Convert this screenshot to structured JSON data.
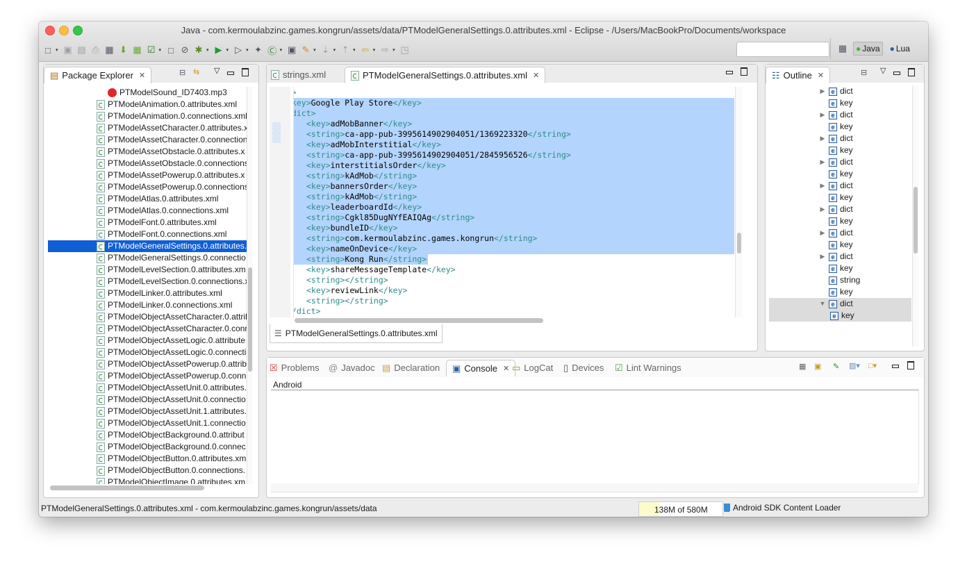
{
  "window": {
    "title": "Java - com.kermoulabzinc.games.kongrun/assets/data/PTModelGeneralSettings.0.attributes.xml - Eclipse - /Users/MacBookPro/Documents/workspace"
  },
  "toolbar": {
    "icons": [
      "new-wizard-icon",
      "save-icon",
      "save-all-icon",
      "print-icon",
      "android-sdk-manager-icon",
      "android-avd-manager-icon",
      "android-lint-icon",
      "checkbox-icon",
      "new-android-xml-icon",
      "skip-breakpoints-icon",
      "debug-icon",
      "run-icon",
      "run-external-tool-icon",
      "new-java-package-icon",
      "new-java-class-icon",
      "open-type-icon",
      "search-icon",
      "next-annotation-icon",
      "prev-annotation-icon",
      "back-icon",
      "forward-icon",
      "pin-editor-icon"
    ],
    "search_placeholder": "",
    "perspectives": [
      {
        "label": "Java",
        "active": true
      },
      {
        "label": "Lua",
        "active": false
      }
    ]
  },
  "package_explorer": {
    "title": "Package Explorer",
    "items": [
      {
        "label": "PTModelSound_ID7403.mp3",
        "type": "mp3"
      },
      {
        "label": "PTModelAnimation.0.attributes.xml"
      },
      {
        "label": "PTModelAnimation.0.connections.xml"
      },
      {
        "label": "PTModelAssetCharacter.0.attributes.x"
      },
      {
        "label": "PTModelAssetCharacter.0.connection"
      },
      {
        "label": "PTModelAssetObstacle.0.attributes.x"
      },
      {
        "label": "PTModelAssetObstacle.0.connections"
      },
      {
        "label": "PTModelAssetPowerup.0.attributes.x"
      },
      {
        "label": "PTModelAssetPowerup.0.connections"
      },
      {
        "label": "PTModelAtlas.0.attributes.xml"
      },
      {
        "label": "PTModelAtlas.0.connections.xml"
      },
      {
        "label": "PTModelFont.0.attributes.xml"
      },
      {
        "label": "PTModelFont.0.connections.xml"
      },
      {
        "label": "PTModelGeneralSettings.0.attributes.",
        "selected": true
      },
      {
        "label": "PTModelGeneralSettings.0.connectio"
      },
      {
        "label": "PTModelLevelSection.0.attributes.xm"
      },
      {
        "label": "PTModelLevelSection.0.connections.x"
      },
      {
        "label": "PTModelLinker.0.attributes.xml"
      },
      {
        "label": "PTModelLinker.0.connections.xml"
      },
      {
        "label": "PTModelObjectAssetCharacter.0.attril"
      },
      {
        "label": "PTModelObjectAssetCharacter.0.conr"
      },
      {
        "label": "PTModelObjectAssetLogic.0.attribute"
      },
      {
        "label": "PTModelObjectAssetLogic.0.connecti"
      },
      {
        "label": "PTModelObjectAssetPowerup.0.attrib"
      },
      {
        "label": "PTModelObjectAssetPowerup.0.conn"
      },
      {
        "label": "PTModelObjectAssetUnit.0.attributes."
      },
      {
        "label": "PTModelObjectAssetUnit.0.connectio"
      },
      {
        "label": "PTModelObjectAssetUnit.1.attributes."
      },
      {
        "label": "PTModelObjectAssetUnit.1.connectio"
      },
      {
        "label": "PTModelObjectBackground.0.attribut"
      },
      {
        "label": "PTModelObjectBackground.0.connec"
      },
      {
        "label": "PTModelObjectButton.0.attributes.xm"
      },
      {
        "label": "PTModelObjectButton.0.connections."
      },
      {
        "label": "PTModelObjectImage.0.attributes.xm"
      }
    ]
  },
  "editor": {
    "tabs": [
      {
        "label": "strings.xml",
        "active": false
      },
      {
        "label": "PTModelGeneralSettings.0.attributes.xml",
        "active": true
      }
    ],
    "bottom_tab": "PTModelGeneralSettings.0.attributes.xml",
    "lines": [
      {
        "indent": 4,
        "parts": [
          [
            "tag",
            "<dict>"
          ]
        ]
      },
      {
        "indent": 5,
        "parts": [
          [
            "tag",
            "<key>"
          ],
          [
            "txt",
            "Google Play Store"
          ],
          [
            "tag",
            "</key>"
          ]
        ]
      },
      {
        "indent": 5,
        "parts": [
          [
            "tag",
            "<dict>"
          ]
        ]
      },
      {
        "indent": 6,
        "parts": [
          [
            "tag",
            "<key>"
          ],
          [
            "txt",
            "adMobBanner"
          ],
          [
            "tag",
            "</key>"
          ]
        ]
      },
      {
        "indent": 6,
        "parts": [
          [
            "tag",
            "<string>"
          ],
          [
            "txt",
            "ca-app-pub-3995614902904051/1369223320"
          ],
          [
            "tag",
            "</string>"
          ]
        ]
      },
      {
        "indent": 6,
        "parts": [
          [
            "tag",
            "<key>"
          ],
          [
            "txt",
            "adMobInterstitial"
          ],
          [
            "tag",
            "</key>"
          ]
        ]
      },
      {
        "indent": 6,
        "parts": [
          [
            "tag",
            "<string>"
          ],
          [
            "txt",
            "ca-app-pub-3995614902904051/2845956526"
          ],
          [
            "tag",
            "</string>"
          ]
        ]
      },
      {
        "indent": 6,
        "parts": [
          [
            "tag",
            "<key>"
          ],
          [
            "txt",
            "interstitialsOrder"
          ],
          [
            "tag",
            "</key>"
          ]
        ]
      },
      {
        "indent": 6,
        "parts": [
          [
            "tag",
            "<string>"
          ],
          [
            "txt",
            "kAdMob"
          ],
          [
            "tag",
            "</string>"
          ]
        ]
      },
      {
        "indent": 6,
        "parts": [
          [
            "tag",
            "<key>"
          ],
          [
            "txt",
            "bannersOrder"
          ],
          [
            "tag",
            "</key>"
          ]
        ]
      },
      {
        "indent": 6,
        "parts": [
          [
            "tag",
            "<string>"
          ],
          [
            "txt",
            "kAdMob"
          ],
          [
            "tag",
            "</string>"
          ]
        ]
      },
      {
        "indent": 6,
        "parts": [
          [
            "tag",
            "<key>"
          ],
          [
            "txt",
            "leaderboardId"
          ],
          [
            "tag",
            "</key>"
          ]
        ]
      },
      {
        "indent": 6,
        "parts": [
          [
            "tag",
            "<string>"
          ],
          [
            "txt",
            "Cgkl85DugNYfEAIQAg"
          ],
          [
            "tag",
            "</string>"
          ]
        ]
      },
      {
        "indent": 6,
        "parts": [
          [
            "tag",
            "<key>"
          ],
          [
            "txt",
            "bundleID"
          ],
          [
            "tag",
            "</key>"
          ]
        ]
      },
      {
        "indent": 6,
        "parts": [
          [
            "tag",
            "<string>"
          ],
          [
            "txt",
            "com.kermoulabzinc.games.kongrun"
          ],
          [
            "tag",
            "</string>"
          ]
        ]
      },
      {
        "indent": 6,
        "parts": [
          [
            "tag",
            "<key>"
          ],
          [
            "txt",
            "nameOnDevice"
          ],
          [
            "tag",
            "</key>"
          ]
        ]
      },
      {
        "indent": 6,
        "parts": [
          [
            "tag",
            "<string>"
          ],
          [
            "txt",
            "Kong Run"
          ],
          [
            "tag",
            "</string>"
          ]
        ]
      },
      {
        "indent": 6,
        "parts": [
          [
            "tag",
            "<key>"
          ],
          [
            "txt",
            "shareMessageTemplate"
          ],
          [
            "tag",
            "</key>"
          ]
        ]
      },
      {
        "indent": 6,
        "parts": [
          [
            "tag",
            "<string>"
          ],
          [
            "tag",
            "</string>"
          ]
        ]
      },
      {
        "indent": 6,
        "parts": [
          [
            "tag",
            "<key>"
          ],
          [
            "txt",
            "reviewLink"
          ],
          [
            "tag",
            "</key>"
          ]
        ]
      },
      {
        "indent": 6,
        "parts": [
          [
            "tag",
            "<string>"
          ],
          [
            "tag",
            "</string>"
          ]
        ]
      },
      {
        "indent": 5,
        "parts": [
          [
            "tag",
            "</dict>"
          ]
        ]
      }
    ],
    "selection": {
      "first_line": 1,
      "last_line": 16
    }
  },
  "outline": {
    "title": "Outline",
    "items": [
      {
        "label": "dict",
        "expandable": true,
        "depth": 0
      },
      {
        "label": "key",
        "depth": 0
      },
      {
        "label": "dict",
        "expandable": true,
        "depth": 0
      },
      {
        "label": "key",
        "depth": 0
      },
      {
        "label": "dict",
        "expandable": true,
        "depth": 0
      },
      {
        "label": "key",
        "depth": 0
      },
      {
        "label": "dict",
        "expandable": true,
        "depth": 0
      },
      {
        "label": "key",
        "depth": 0
      },
      {
        "label": "dict",
        "expandable": true,
        "depth": 0
      },
      {
        "label": "key",
        "depth": 0
      },
      {
        "label": "dict",
        "expandable": true,
        "depth": 0
      },
      {
        "label": "key",
        "depth": 0
      },
      {
        "label": "dict",
        "expandable": true,
        "depth": 0
      },
      {
        "label": "key",
        "depth": 0
      },
      {
        "label": "dict",
        "expandable": true,
        "depth": 0
      },
      {
        "label": "key",
        "depth": 0
      },
      {
        "label": "string",
        "depth": 0
      },
      {
        "label": "key",
        "depth": 0
      },
      {
        "label": "dict",
        "expanded": true,
        "depth": 0,
        "selected": true
      },
      {
        "label": "key",
        "depth": 1,
        "selected": true
      }
    ]
  },
  "console_view": {
    "tabs": [
      {
        "label": "Problems",
        "icon": "problems-icon"
      },
      {
        "label": "Javadoc",
        "icon": "javadoc-icon"
      },
      {
        "label": "Declaration",
        "icon": "declaration-icon"
      },
      {
        "label": "Console",
        "icon": "console-icon",
        "active": true
      },
      {
        "label": "LogCat",
        "icon": "logcat-icon"
      },
      {
        "label": "Devices",
        "icon": "devices-icon"
      },
      {
        "label": "Lint Warnings",
        "icon": "lint-warnings-icon"
      }
    ],
    "console_name": "Android"
  },
  "status": {
    "path": "PTModelGeneralSettings.0.attributes.xml - com.kermoulabzinc.games.kongrun/assets/data",
    "heap": "138M of 580M",
    "heap_used_fraction": 0.238,
    "loader": "Android SDK Content Loader"
  }
}
